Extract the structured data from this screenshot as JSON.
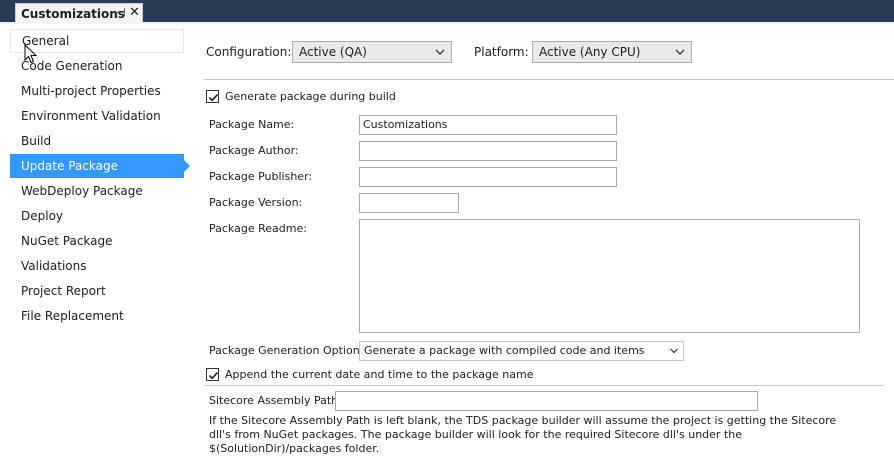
{
  "tab": {
    "title": "Customizations",
    "pin_glyph": "⊣",
    "close_glyph": "✕"
  },
  "sidebar": {
    "items": [
      {
        "label": "General"
      },
      {
        "label": "Code Generation"
      },
      {
        "label": "Multi-project Properties"
      },
      {
        "label": "Environment Validation"
      },
      {
        "label": "Build"
      },
      {
        "label": "Update Package",
        "selected": true
      },
      {
        "label": "WebDeploy Package"
      },
      {
        "label": "Deploy"
      },
      {
        "label": "NuGet Package"
      },
      {
        "label": "Validations"
      },
      {
        "label": "Project Report"
      },
      {
        "label": "File Replacement"
      }
    ]
  },
  "config": {
    "configuration_label": "Configuration:",
    "configuration_value": "Active (QA)",
    "platform_label": "Platform:",
    "platform_value": "Active (Any CPU)"
  },
  "package": {
    "generate_label": "Generate package during build",
    "generate_checked": true,
    "name_label": "Package Name:",
    "name_value": "Customizations",
    "author_label": "Package Author:",
    "author_value": "",
    "publisher_label": "Package Publisher:",
    "publisher_value": "",
    "version_label": "Package Version:",
    "version_value": "",
    "readme_label": "Package Readme:",
    "readme_value": "",
    "options_label": "Package Generation Options:",
    "options_value": "Generate a package with compiled code and items",
    "append_label": "Append the current date and time to the package name",
    "append_checked": true
  },
  "sitecore": {
    "assembly_label": "Sitecore Assembly Path:",
    "assembly_value": "",
    "note": "If the Sitecore Assembly Path is left blank, the TDS package builder will assume the project is getting the Sitecore dll's from NuGet packages. The package builder will look for the required Sitecore dll's under the $(SolutionDir)/packages folder."
  },
  "colors": {
    "selected_bg": "#3399ff",
    "tabstrip_bg": "#2b3a55"
  }
}
